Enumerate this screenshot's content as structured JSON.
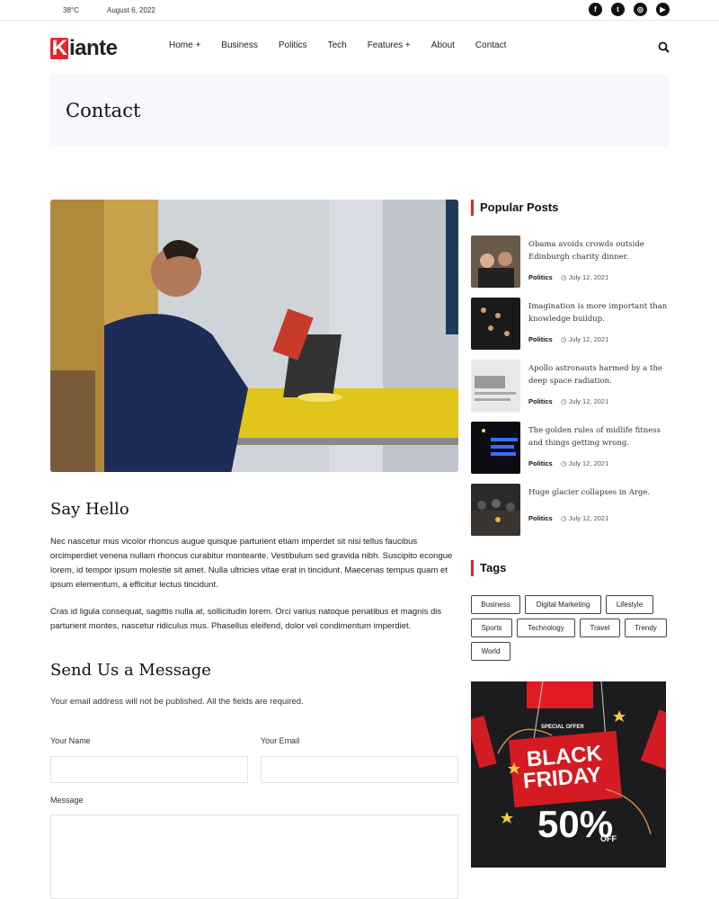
{
  "topbar": {
    "temperature": "38°C",
    "date": "August 6, 2022"
  },
  "social": [
    {
      "icon": "facebook-icon",
      "glyph": "f"
    },
    {
      "icon": "twitter-icon",
      "glyph": "t"
    },
    {
      "icon": "instagram-icon",
      "glyph": "◎"
    },
    {
      "icon": "youtube-icon",
      "glyph": "▶"
    }
  ],
  "header": {
    "logo_first": "K",
    "logo_rest": "iante",
    "nav": [
      "Home +",
      "Business",
      "Politics",
      "Tech",
      "Features +",
      "About",
      "Contact"
    ]
  },
  "banner": {
    "title": "Contact"
  },
  "main": {
    "say_hello_title": "Say Hello",
    "para1": "Nec nascetur mus vicolor rhoncus augue quisque parturient etiam imperdet sit nisi tellus faucibus orcimperdiet venena nullam rhoncus curabitur monteante. Vestibulum sed gravida nibh. Suscipito econgue lorem, id tempor ipsum molestie sit amet. Nulla ultricies vitae erat in tincidunt. Maecenas tempus quam et ipsum elementum, a efficitur lectus tincidunt.",
    "para2": "Cras id ligula consequat, sagittis nulla at, sollicitudin lorem. Orci varius natoque penatibus et magnis dis parturient montes, nascetur ridiculus mus. Phasellus eleifend, dolor vel condimentum imperdiet.",
    "form_title": "Send Us a Message",
    "form_note": "Your email address will not be published. All the fields are required.",
    "name_label": "Your Name",
    "email_label": "Your Email",
    "message_label": "Message"
  },
  "sidebar": {
    "popular_title": "Popular Posts",
    "posts": [
      {
        "title": "Obama avoids crowds outside Edinburgh charity dinner.",
        "category": "Politics",
        "date": "July 12, 2021"
      },
      {
        "title": "Imagination is more important than knowledge buildup.",
        "category": "Politics",
        "date": "July 12, 2021"
      },
      {
        "title": "Apollo astronauts harmed by a the deep space radiation.",
        "category": "Politics",
        "date": "July 12, 2021"
      },
      {
        "title": "The golden rules of midlife fitness and things getting wrong.",
        "category": "Politics",
        "date": "July 12, 2021"
      },
      {
        "title": "Huge glacier collapses in Arge.",
        "category": "Politics",
        "date": "July 12, 2021"
      }
    ],
    "tags_title": "Tags",
    "tags": [
      "Business",
      "Digital Marketing",
      "Lifestyle",
      "Sports",
      "Technology",
      "Travel",
      "Trendy",
      "World"
    ],
    "ad": {
      "special": "SPECIAL OFFER",
      "line1": "BLACK",
      "line2": "FRIDAY",
      "percent": "50%",
      "off": "OFF"
    }
  },
  "colors": {
    "accent": "#e4252b",
    "banner_bg": "#f7f7fc"
  }
}
